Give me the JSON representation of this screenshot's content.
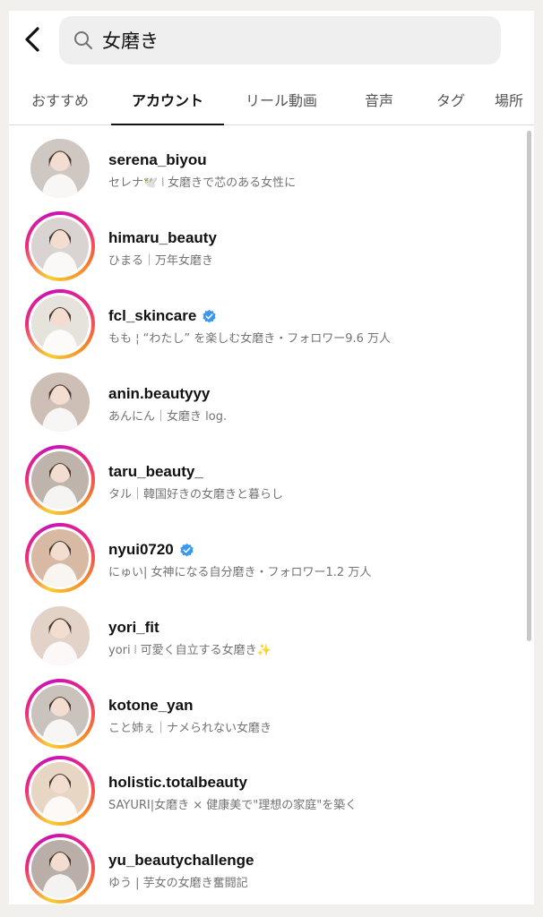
{
  "search": {
    "query": "女磨き"
  },
  "tabs": [
    {
      "label": "おすすめ"
    },
    {
      "label": "アカウント"
    },
    {
      "label": "リール動画"
    },
    {
      "label": "音声"
    },
    {
      "label": "タグ"
    },
    {
      "label": "場所"
    }
  ],
  "active_tab": "アカウント",
  "accounts": [
    {
      "username": "serena_biyou",
      "subtitle": "セレナ🕊️ ⦚ 女磨きで芯のある女性に",
      "verified": false,
      "story": false,
      "avatar_color": "#cfc8c2"
    },
    {
      "username": "himaru_beauty",
      "subtitle": "ひまる｜万年女磨き",
      "verified": false,
      "story": true,
      "avatar_color": "#d9d4d1"
    },
    {
      "username": "fcl_skincare",
      "subtitle": "もも ¦ “わたし” を楽しむ女磨き・フォロワー9.6 万人",
      "verified": true,
      "story": true,
      "avatar_color": "#e6e2dc"
    },
    {
      "username": "anin.beautyyy",
      "subtitle": "あんにん｜女磨き log.",
      "verified": false,
      "story": false,
      "avatar_color": "#cdbfb5"
    },
    {
      "username": "taru_beauty_",
      "subtitle": "タル｜韓国好きの女磨きと暮らし",
      "verified": false,
      "story": true,
      "avatar_color": "#bfb4ac"
    },
    {
      "username": "nyui0720",
      "subtitle": "にゅい| 女神になる自分磨き・フォロワー1.2 万人",
      "verified": true,
      "story": true,
      "avatar_color": "#d8b9a3"
    },
    {
      "username": "yori_fit",
      "subtitle": "yori ⦚ 可愛く自立する女磨き✨",
      "verified": false,
      "story": false,
      "avatar_color": "#e2d2c8"
    },
    {
      "username": "kotone_yan",
      "subtitle": "こと姉ぇ｜ナメられない女磨き",
      "verified": false,
      "story": true,
      "avatar_color": "#c9c2bd"
    },
    {
      "username": "holistic.totalbeauty",
      "subtitle": "SAYURI|女磨き × 健康美で\"理想の家庭\"を築く",
      "verified": false,
      "story": true,
      "avatar_color": "#e8d6c4"
    },
    {
      "username": "yu_beautychallenge",
      "subtitle": "ゆう | 芋女の女磨き奮闘記",
      "verified": false,
      "story": true,
      "avatar_color": "#b9aea8"
    }
  ],
  "icons": {
    "back": "chevron-left-icon",
    "search": "search-icon",
    "verified": "verified-badge-icon"
  },
  "colors": {
    "verified": "#3897f0",
    "story_ring": "#ee2a7b"
  }
}
